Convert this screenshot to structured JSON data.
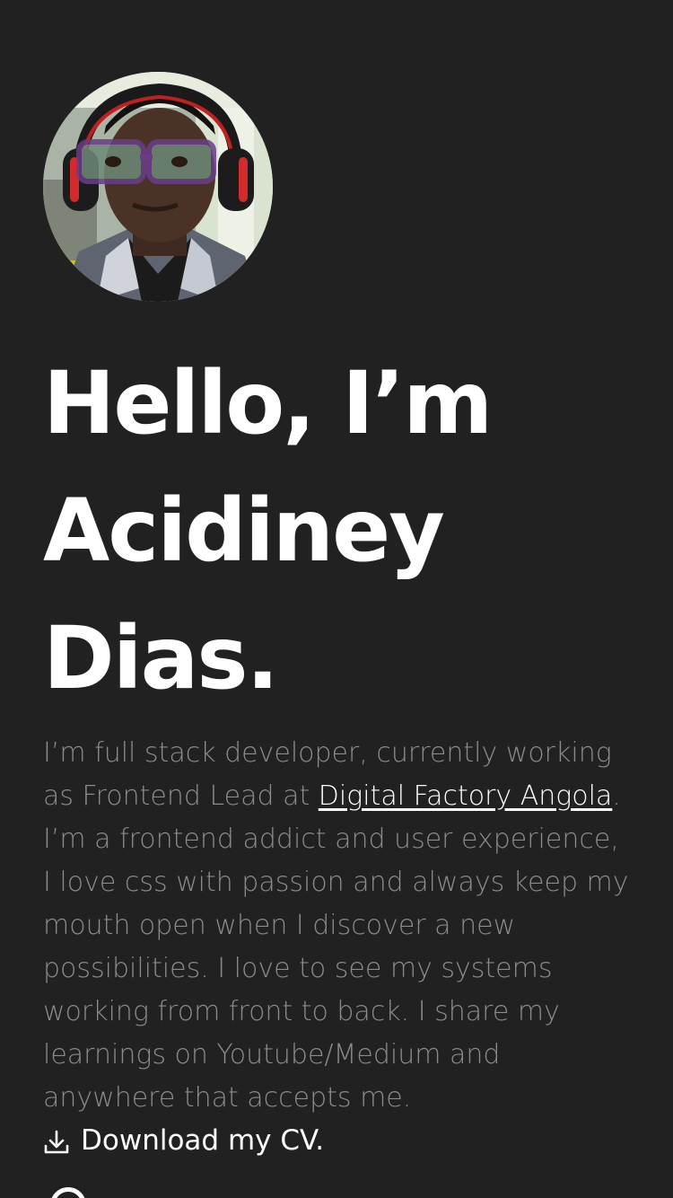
{
  "profile": {
    "avatar_alt": "Profile photo"
  },
  "hero": {
    "line1": "Hello, I’m",
    "line2": "Acidiney",
    "line3": "Dias."
  },
  "bio": {
    "before_link": "I’m full stack developer, currently working as Frontend Lead at ",
    "link_text": "Digital Factory Angola",
    "after_link": ". I’m a frontend addict and user experience, I love css with passion and always keep my mouth open when I discover a new possibilities. I love to see my systems working from front to back. I share my learnings on Youtube/Medium and anywhere that accepts me."
  },
  "actions": {
    "download_cv": "Download my CV.",
    "download_icon": "download-icon"
  },
  "colors": {
    "background": "#212121",
    "text_primary": "#ffffff",
    "text_muted": "#8b8b8b"
  }
}
